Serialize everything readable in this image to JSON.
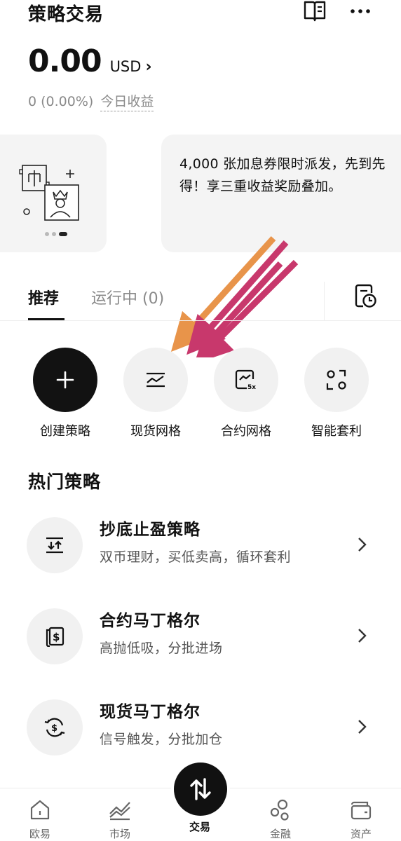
{
  "header": {
    "title": "策略交易",
    "book_icon": "book-icon",
    "more_icon": "more-icon"
  },
  "balance": {
    "value": "0.00",
    "unit": "USD",
    "chevron": "›"
  },
  "pnl": {
    "value": "0 (0.00%)",
    "label": "今日收益"
  },
  "banner": {
    "text": "4,000 张加息券限时派发，先到先得！享三重收益奖励叠加。",
    "page_count": 3,
    "active_page": 3
  },
  "tabs": [
    {
      "label": "推荐",
      "active": true
    },
    {
      "label": "运行中 (0)",
      "active": false
    }
  ],
  "quick_actions": [
    {
      "label": "创建策略",
      "icon": "plus-icon"
    },
    {
      "label": "现货网格",
      "icon": "spot-grid-icon"
    },
    {
      "label": "合约网格",
      "icon": "futures-grid-icon"
    },
    {
      "label": "智能套利",
      "icon": "arbitrage-icon"
    }
  ],
  "hot": {
    "title": "热门策略",
    "items": [
      {
        "name": "抄底止盈策略",
        "desc": "双币理财，买低卖高，循环套利",
        "icon": "buy-sell-icon"
      },
      {
        "name": "合约马丁格尔",
        "desc": "高抛低吸，分批进场",
        "icon": "futures-martingale-icon"
      },
      {
        "name": "现货马丁格尔",
        "desc": "信号触发，分批加仓",
        "icon": "spot-martingale-icon"
      }
    ]
  },
  "nav": [
    {
      "label": "欧易",
      "icon": "home-icon"
    },
    {
      "label": "市场",
      "icon": "market-icon"
    },
    {
      "label": "交易",
      "icon": "trade-icon",
      "active": true
    },
    {
      "label": "金融",
      "icon": "finance-icon"
    },
    {
      "label": "资产",
      "icon": "wallet-icon"
    }
  ],
  "colors": {
    "primary": "#111111",
    "muted": "#8a8a8a",
    "card_bg": "#f4f4f4",
    "arrow_orange": "#e8944a",
    "arrow_magenta": "#c8386c"
  }
}
